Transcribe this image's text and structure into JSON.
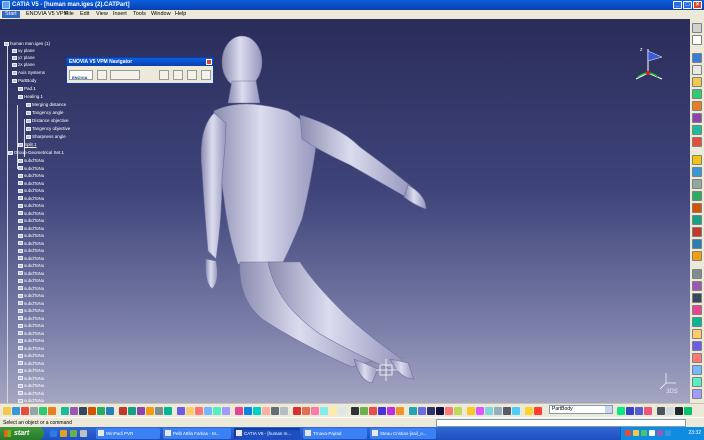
{
  "window": {
    "title": "CATIA V5 - [human man.iges (2).CATPart]"
  },
  "menu": {
    "items": [
      "Start",
      "ENOVIA V5 VPM",
      "File",
      "Edit",
      "View",
      "Insert",
      "Tools",
      "Window",
      "Help"
    ]
  },
  "tree": {
    "root": "human man.iges (1)",
    "nodes": [
      "xy plane",
      "yz plane",
      "zx plane",
      "Axis Systems",
      "PartBody",
      "Pad.1",
      "Healing.1",
      "Merging distance",
      "Tangency angle",
      "Distance objective",
      "Tangency objective",
      "Sharpness angle",
      "Split.1",
      "Group-Geometrical Set.1"
    ],
    "repeat_label": "subdToNu",
    "repeat_count": 34
  },
  "navigator": {
    "title": "ENOVIA V5 VPM Navigator",
    "brand": "ENOVIA"
  },
  "combo": {
    "value": "PartBody"
  },
  "status": {
    "text": "Select an object or a command"
  },
  "taskbar": {
    "start": "start",
    "tasks": [
      "WinPadi PVR",
      "Pelb Attila Farkas - M...",
      "CATIA V5 - [human m...",
      "Trnava-Pajrad",
      "Steau Cristian-[sail_o..."
    ],
    "clock": "23:32"
  },
  "brand_corner": "CATIA"
}
